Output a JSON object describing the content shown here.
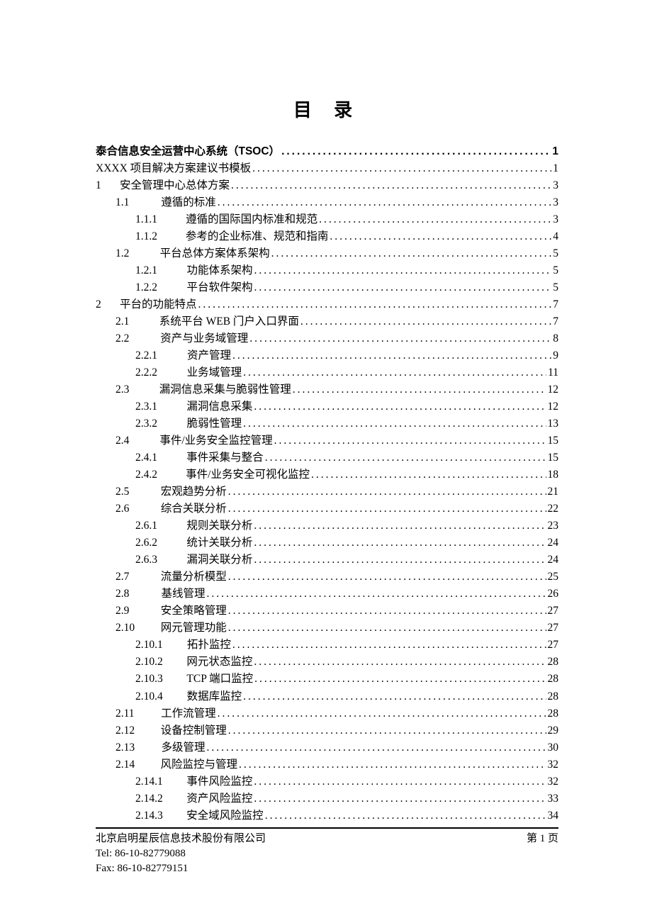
{
  "title": "目 录",
  "entries": [
    {
      "indent": "lvl0pre",
      "num": "",
      "title": "泰合信息安全运营中心系统（TSOC）",
      "page": "1",
      "bold": true
    },
    {
      "indent": "lvl0pre",
      "num": "",
      "title": "XXXX 项目解决方案建议书模板",
      "page": "1",
      "bold": false
    },
    {
      "indent": "lvl0",
      "num": "1",
      "title": "安全管理中心总体方案",
      "page": "3",
      "bold": false,
      "topnum": true
    },
    {
      "indent": "lvl1",
      "num": "1.1",
      "title": "遵循的标准",
      "page": "3",
      "gap": "gap1"
    },
    {
      "indent": "lvl2",
      "num": "1.1.1",
      "title": "遵循的国际国内标准和规范",
      "page": "3",
      "gap": "gap2"
    },
    {
      "indent": "lvl2",
      "num": "1.1.2",
      "title": "参考的企业标准、规范和指南",
      "page": "4",
      "gap": "gap2"
    },
    {
      "indent": "lvl1",
      "num": "1.2",
      "title": "平台总体方案体系架构",
      "page": "5",
      "gap": "gap1"
    },
    {
      "indent": "lvl2",
      "num": "1.2.1",
      "title": "功能体系架构",
      "page": "5",
      "gap": "gap2"
    },
    {
      "indent": "lvl2",
      "num": "1.2.2",
      "title": "平台软件架构",
      "page": "5",
      "gap": "gap2"
    },
    {
      "indent": "lvl0",
      "num": "2",
      "title": "平台的功能特点",
      "page": "7",
      "bold": false,
      "topnum": true
    },
    {
      "indent": "lvl1",
      "num": "2.1",
      "title": "系统平台 WEB 门户入口界面",
      "page": "7",
      "gap": "gap1"
    },
    {
      "indent": "lvl1",
      "num": "2.2",
      "title": "资产与业务域管理",
      "page": "8",
      "gap": "gap1"
    },
    {
      "indent": "lvl2",
      "num": "2.2.1",
      "title": "资产管理",
      "page": "9",
      "gap": "gap2"
    },
    {
      "indent": "lvl2",
      "num": "2.2.2",
      "title": "业务域管理",
      "page": "11",
      "gap": "gap2"
    },
    {
      "indent": "lvl1",
      "num": "2.3",
      "title": "漏洞信息采集与脆弱性管理",
      "page": "12",
      "gap": "gap1"
    },
    {
      "indent": "lvl2",
      "num": "2.3.1",
      "title": "漏洞信息采集",
      "page": "12",
      "gap": "gap2"
    },
    {
      "indent": "lvl2",
      "num": "2.3.2",
      "title": "脆弱性管理",
      "page": "13",
      "gap": "gap2"
    },
    {
      "indent": "lvl1",
      "num": "2.4",
      "title": "事件/业务安全监控管理",
      "page": "15",
      "gap": "gap1"
    },
    {
      "indent": "lvl2",
      "num": "2.4.1",
      "title": "事件采集与整合",
      "page": "15",
      "gap": "gap2"
    },
    {
      "indent": "lvl2",
      "num": "2.4.2",
      "title": "事件/业务安全可视化监控",
      "page": "18",
      "gap": "gap2"
    },
    {
      "indent": "lvl1",
      "num": "2.5",
      "title": "宏观趋势分析",
      "page": "21",
      "gap": "gap1"
    },
    {
      "indent": "lvl1",
      "num": "2.6",
      "title": "综合关联分析",
      "page": "22",
      "gap": "gap1"
    },
    {
      "indent": "lvl2",
      "num": "2.6.1",
      "title": "规则关联分析",
      "page": "23",
      "gap": "gap2"
    },
    {
      "indent": "lvl2",
      "num": "2.6.2",
      "title": "统计关联分析",
      "page": "24",
      "gap": "gap2"
    },
    {
      "indent": "lvl2",
      "num": "2.6.3",
      "title": "漏洞关联分析",
      "page": "24",
      "gap": "gap2"
    },
    {
      "indent": "lvl1",
      "num": "2.7",
      "title": "流量分析模型",
      "page": "25",
      "gap": "gap1"
    },
    {
      "indent": "lvl1",
      "num": "2.8",
      "title": "基线管理",
      "page": "26",
      "gap": "gap1"
    },
    {
      "indent": "lvl1",
      "num": "2.9",
      "title": "安全策略管理",
      "page": "27",
      "gap": "gap1"
    },
    {
      "indent": "lvl1",
      "num": "2.10",
      "title": "网元管理功能",
      "page": "27",
      "gap": "gap1"
    },
    {
      "indent": "lvl2",
      "num": "2.10.1",
      "title": "拓扑监控",
      "page": "27",
      "gap": "gap2"
    },
    {
      "indent": "lvl2",
      "num": "2.10.2",
      "title": "网元状态监控",
      "page": "28",
      "gap": "gap2"
    },
    {
      "indent": "lvl2",
      "num": "2.10.3",
      "title": "TCP 端口监控",
      "page": "28",
      "gap": "gap2"
    },
    {
      "indent": "lvl2",
      "num": "2.10.4",
      "title": "数据库监控",
      "page": "28",
      "gap": "gap2"
    },
    {
      "indent": "lvl1",
      "num": "2.11",
      "title": "工作流管理",
      "page": "28",
      "gap": "gap1"
    },
    {
      "indent": "lvl1",
      "num": "2.12",
      "title": "设备控制管理",
      "page": "29",
      "gap": "gap1"
    },
    {
      "indent": "lvl1",
      "num": "2.13",
      "title": "多级管理",
      "page": "30",
      "gap": "gap1"
    },
    {
      "indent": "lvl1",
      "num": "2.14",
      "title": "风险监控与管理",
      "page": "32",
      "gap": "gap1"
    },
    {
      "indent": "lvl2",
      "num": "2.14.1",
      "title": "事件风险监控",
      "page": "32",
      "gap": "gap2"
    },
    {
      "indent": "lvl2",
      "num": "2.14.2",
      "title": "资产风险监控",
      "page": "33",
      "gap": "gap2"
    },
    {
      "indent": "lvl2",
      "num": "2.14.3",
      "title": "安全域风险监控",
      "page": "34",
      "gap": "gap2"
    }
  ],
  "footer": {
    "company": "北京启明星辰信息技术股份有限公司",
    "tel": "Tel: 86-10-82779088",
    "fax": "Fax: 86-10-82779151",
    "page": "第 1 页"
  }
}
